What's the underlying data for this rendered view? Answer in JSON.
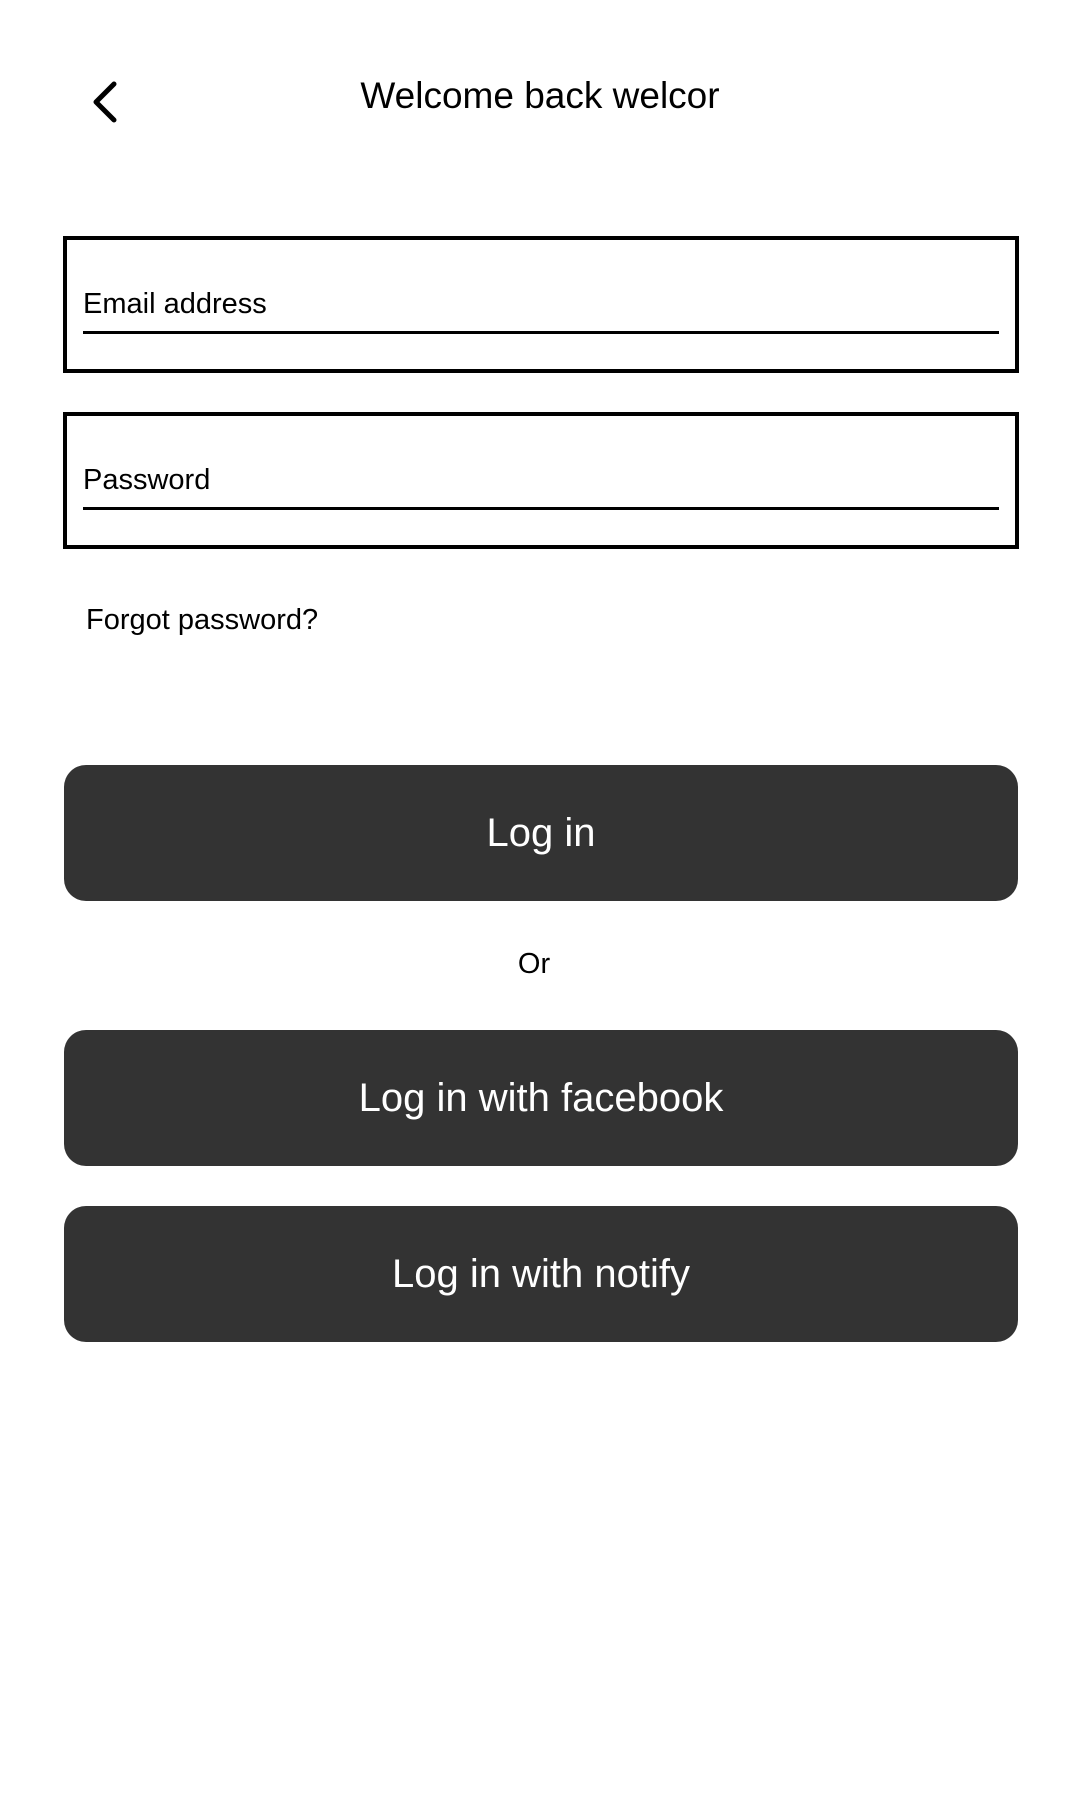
{
  "header": {
    "back_icon": "chevron-left-icon",
    "title": "Welcome back welcor"
  },
  "form": {
    "email": {
      "value": "",
      "placeholder": "Email address"
    },
    "password": {
      "value": "",
      "placeholder": "Password"
    },
    "forgot_password_label": "Forgot password?"
  },
  "actions": {
    "login_label": "Log in",
    "or_label": "Or",
    "facebook_label": "Log in with facebook",
    "notify_label": "Log in with notify"
  },
  "colors": {
    "button_background": "#333333",
    "button_text": "#ffffff",
    "border": "#000000",
    "background": "#ffffff"
  }
}
